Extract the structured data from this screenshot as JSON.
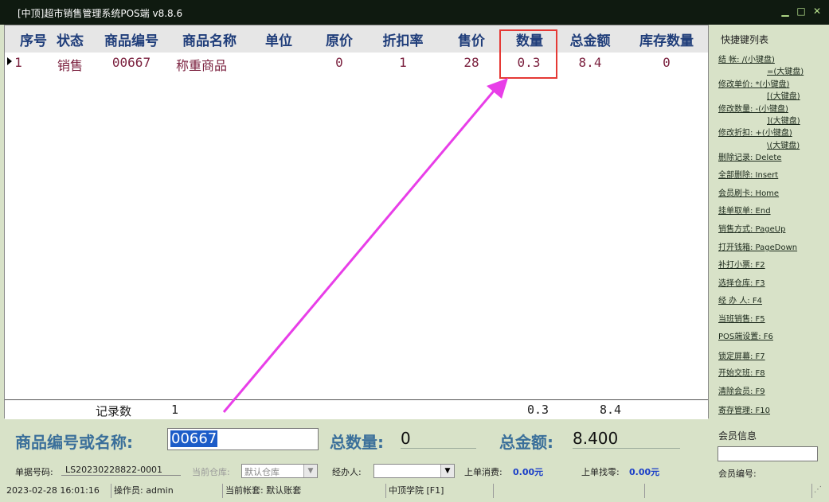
{
  "window": {
    "title": "[中顶]超市销售管理系统POS端 v8.8.6"
  },
  "table": {
    "headers": [
      "序号",
      "状态",
      "商品编号",
      "商品名称",
      "单位",
      "原价",
      "折扣率",
      "售价",
      "数量",
      "总金额",
      "库存数量"
    ],
    "rows": [
      {
        "seq": "1",
        "status": "销售",
        "code": "00667",
        "name": "称重商品",
        "unit": "",
        "orig_price": "0",
        "discount": "1",
        "price": "28",
        "qty": "0.3",
        "total": "8.4",
        "stock": "0"
      }
    ],
    "footer": {
      "label": "记录数",
      "count": "1",
      "qty": "0.3",
      "total": "8.4"
    }
  },
  "shortcuts": {
    "title": "快捷键列表",
    "items": [
      "结    帐: /(小键盘)",
      "=(大键盘)",
      "修改单价: *(小键盘)",
      "[(大键盘)",
      "修改数量: -(小键盘)",
      "](大键盘)",
      "修改折扣: +(小键盘)",
      "\\(大键盘)",
      "删除记录: Delete",
      "全部删除: Insert",
      "会员刷卡: Home",
      "挂单取单: End",
      "销售方式: PageUp",
      "打开钱箱: PageDown",
      "补打小票: F2",
      "选择仓库: F3",
      "经 办 人: F4",
      "当班销售: F5",
      "POS端设置: F6",
      "锁定屏幕: F7",
      "开始交班: F8",
      "清除会员: F9",
      "寄存管理: F10"
    ]
  },
  "entry": {
    "code_label": "商品编号或名称:",
    "code_value": "00667",
    "total_qty_label": "总数量:",
    "total_qty": "0",
    "total_amount_label": "总金额:",
    "total_amount": "8.400"
  },
  "info": {
    "bill_label": "单据号码:",
    "bill_no": "LS20230228822-0001",
    "warehouse_label": "当前仓库:",
    "warehouse": "默认仓库",
    "handler_label": "经办人:",
    "handler": "",
    "last_spend_label": "上单消费:",
    "last_spend": "0.00元",
    "last_change_label": "上单找零:",
    "last_change": "0.00元"
  },
  "member": {
    "info_label": "会员信息",
    "id_label": "会员编号:",
    "value": ""
  },
  "status": {
    "datetime": "2023-02-28 16:01:16",
    "operator": "操作员: admin",
    "account": "当前帐套: 默认账套",
    "company": "中顶学院 [F1]"
  },
  "colors": {
    "header_text": "#1f3d7a",
    "row_text": "#7a1f3d",
    "highlight": "#e53935",
    "arrow": "#e83ee8",
    "label_blue": "#3a6f9a"
  }
}
